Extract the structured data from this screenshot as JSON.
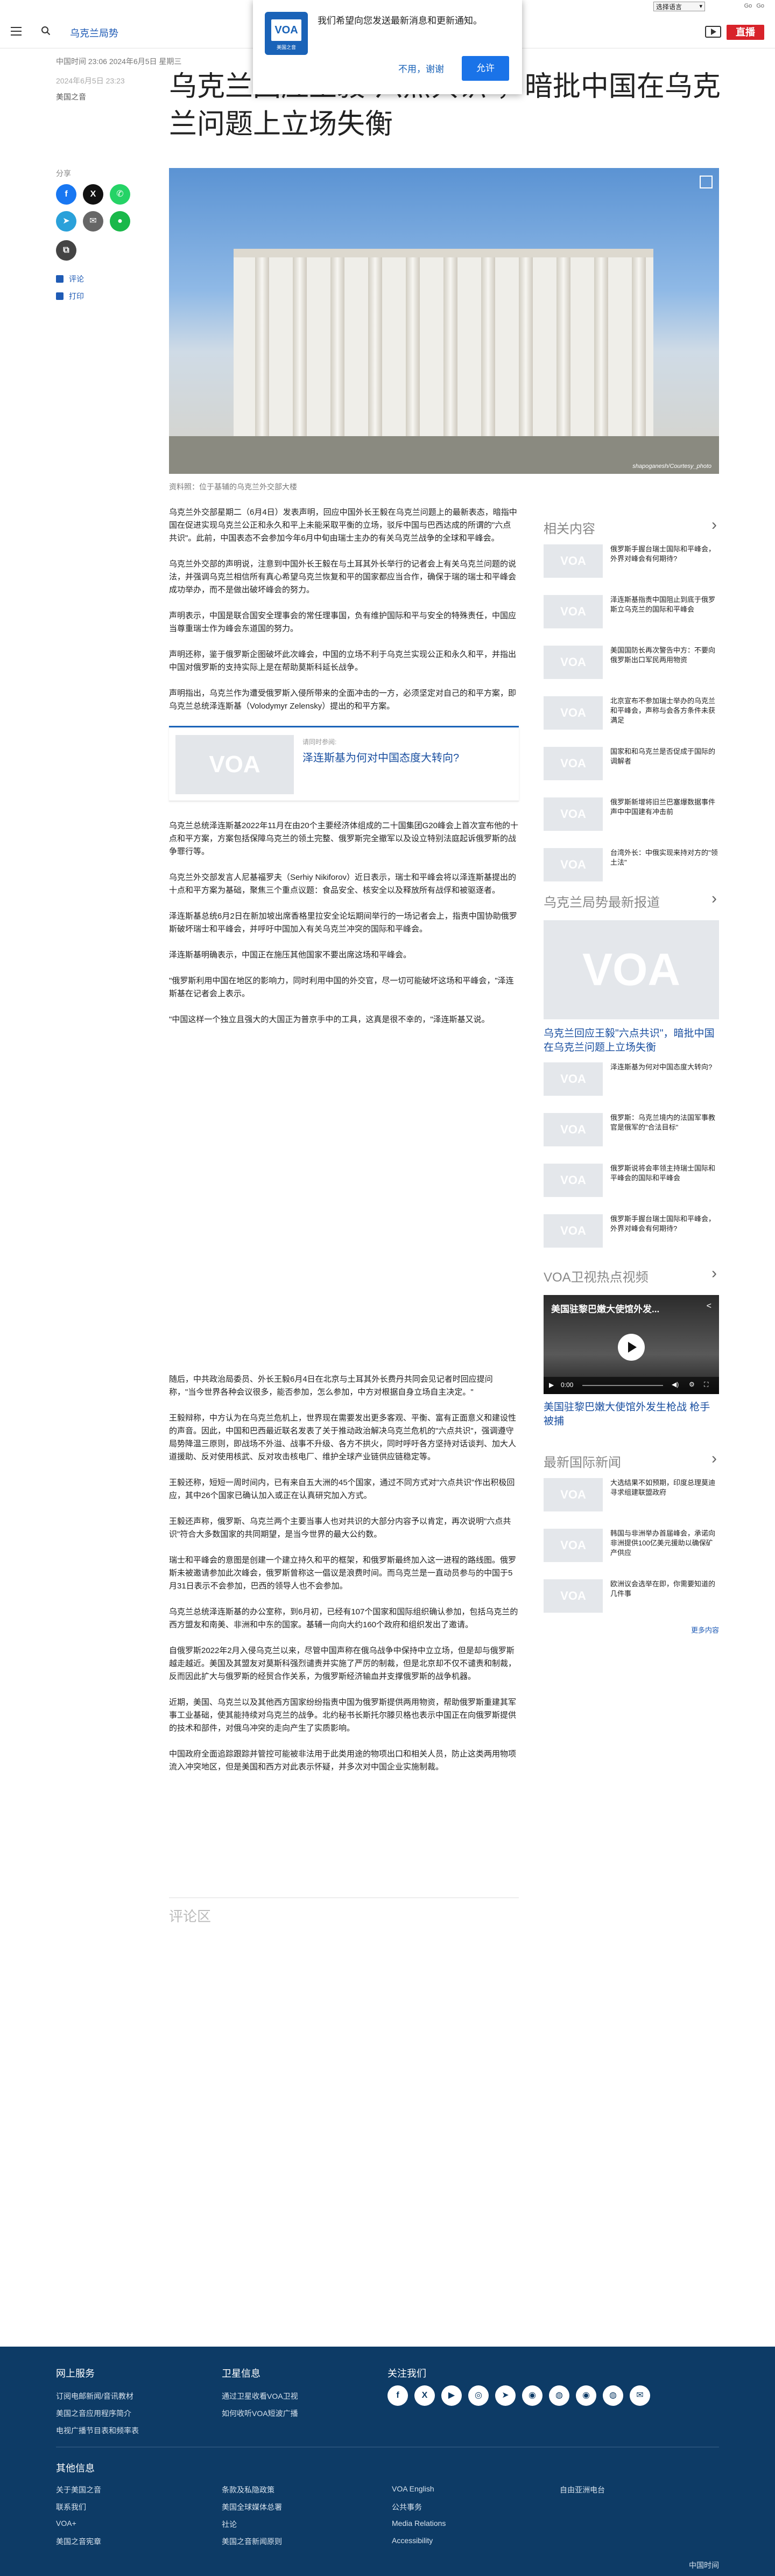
{
  "utility": {
    "language_select": "选择语言",
    "links": [
      "Go",
      "Go"
    ]
  },
  "header": {
    "section": "乌克兰局势",
    "live_label": "直播"
  },
  "notification": {
    "logo_text": "VOA",
    "logo_caption": "美国之音",
    "message": "我们希望向您发送最新消息和更新通知。",
    "no_label": "不用，谢谢",
    "yes_label": "允许"
  },
  "article": {
    "meta_top": "中国时间 23:06 2024年6月5日 星期三",
    "date": "2024年6月5日 23:23",
    "source": "美国之音",
    "title": "乌克兰回应王毅\"六点共识\"，暗批中国在乌克兰问题上立场失衡",
    "share_label": "分享",
    "comment_label": "评论",
    "print_label": "打印",
    "caption": "资料照：位于基辅的乌克兰外交部大楼",
    "photo_credit": "shapoganesh/Courtesy_photo",
    "paragraphs_a": [
      "乌克兰外交部星期二（6月4日）发表声明，回应中国外长王毅在乌克兰问题上的最新表态，暗指中国在促进实现乌克兰公正和永久和平上未能采取平衡的立场，驳斥中国与巴西达成的所谓的\"六点共识\"。此前，中国表态不会参加今年6月中旬由瑞士主办的有关乌克兰战争的全球和平峰会。",
      "乌克兰外交部的声明说，注意到中国外长王毅在与土耳其外长举行的记者会上有关乌克兰问题的说法，并强调乌克兰相信所有真心希望乌克兰恢复和平的国家都应当合作，确保于瑞的瑞士和平峰会成功举办，而不是做出破坏峰会的努力。",
      "声明表示，中国是联合国安全理事会的常任理事国，负有维护国际和平与安全的特殊责任，中国应当尊重瑞士作为峰会东道国的努力。",
      "声明还称，鉴于俄罗斯企图破坏此次峰会，中国的立场不利于乌克兰实现公正和永久和平，并指出中国对俄罗斯的支持实际上是在帮助莫斯科延长战争。",
      "声明指出，乌克兰作为遭受俄罗斯入侵所带来的全面冲击的一方，必须坚定对自己的和平方案，即乌克兰总统泽连斯基（Volodymyr Zelensky）提出的和平方案。"
    ],
    "related": {
      "kicker": "请同时参阅:",
      "title": "泽连斯基为何对中国态度大转向?"
    },
    "paragraphs_b": [
      "乌克兰总统泽连斯基2022年11月在由20个主要经济体组成的二十国集团G20峰会上首次宣布他的十点和平方案，方案包括保障乌克兰的领土完整、俄罗斯完全撤军以及设立特别法庭起诉俄罗斯的战争罪行等。",
      "乌克兰外交部发言人尼基福罗夫（Serhiy Nikiforov）近日表示，瑞士和平峰会将以泽连斯基提出的十点和平方案为基础，聚焦三个重点议题：食品安全、核安全以及释放所有战俘和被驱逐者。",
      "泽连斯基总统6月2日在新加坡出席香格里拉安全论坛期间举行的一场记者会上，指责中国协助俄罗斯破坏瑞士和平峰会，并呼吁中国加入有关乌克兰冲突的国际和平峰会。",
      "泽连斯基明确表示，中国正在施压其他国家不要出席这场和平峰会。",
      "\"俄罗斯利用中国在地区的影响力，同时利用中国的外交官，尽一切可能破坏这场和平峰会，\"泽连斯基在记者会上表示。",
      "\"中国这样一个独立且强大的大国正为普京手中的工具，这真是很不幸的，\"泽连斯基又说。"
    ],
    "paragraphs_c": [
      "随后，中共政治局委员、外长王毅6月4日在北京与土耳其外长费丹共同会见记者时回应提问称，\"当今世界各种会议很多，能否参加，怎么参加，中方对根据自身立场自主决定。\"",
      "王毅辩称，中方认为在乌克兰危机上，世界现在需要发出更多客观、平衡、富有正面意义和建设性的声音。因此，中国和巴西最近联名发表了关于推动政治解决乌克兰危机的\"六点共识\"，强调遵守局势降温三原则，即战场不外溢、战事不升级、各方不拱火，同时呼吁各方坚持对话谈判、加大人道援助、反对使用核武、反对攻击核电厂、维护全球产业链供应链稳定等。",
      "王毅还称，短短一周时间内，已有来自五大洲的45个国家，通过不同方式对\"六点共识\"作出积极回应，其中26个国家已确认加入或正在认真研究加入方式。",
      "王毅还声称，俄罗斯、乌克兰两个主要当事人也对共识的大部分内容予以肯定，再次说明\"六点共识\"符合大多数国家的共同期望，是当今世界的最大公约数。",
      "瑞士和平峰会的意图是创建一个建立持久和平的框架，和俄罗斯最终加入这一进程的路线图。俄罗斯未被邀请参加此次峰会，俄罗斯曾称这一倡议是浪费时间。而乌克兰是一直动员参与的中国于5月31日表示不会参加，巴西的领导人也不会参加。",
      "乌克兰总统泽连斯基的办公室称，到6月初，已经有107个国家和国际组织确认参加，包括乌克兰的西方盟友和南美、非洲和中东的国家。基辅一向向大约160个政府和组织发出了邀请。",
      "自俄罗斯2022年2月入侵乌克兰以来，尽管中国声称在俄乌战争中保持中立立场，但是却与俄罗斯越走越近。美国及其盟友对莫斯科强烈谴责并实施了严厉的制裁，但是北京却不仅不谴责和制裁，反而因此扩大与俄罗斯的经贸合作关系，为俄罗斯经济输血并支撑俄罗斯的战争机器。",
      "近期，美国、乌克兰以及其他西方国家纷纷指责中国为俄罗斯提供两用物资，帮助俄罗斯重建其军事工业基础，使其能持续对乌克兰的战争。北约秘书长斯托尔滕贝格也表示中国正在向俄罗斯提供的技术和部件，对俄乌冲突的走向产生了实质影响。",
      "中国政府全面追踪跟踪并管控可能被非法用于此类用途的物项出口和相关人员，防止这类两用物项流入冲突地区，但是美国和西方对此表示怀疑，并多次对中国企业实施制裁。"
    ],
    "comments_label": "评论区"
  },
  "rail": {
    "related_head": "相关内容",
    "related": [
      "俄罗斯手握台瑞士国际和平峰会，外界对峰会有何期待?",
      "泽连斯基指责中国阻止到底于俄罗斯立乌克兰的国际和平峰会",
      "美国国防长再次警告中方：不要向俄罗斯出口军民两用物资",
      "北京宣布不参加瑞士举办的乌克兰和平峰会，声称与会各方条件未获满足",
      "国家和和乌克兰是否促成于国际的调解者",
      "俄罗斯新增将旧兰巴塞爆数据事件声中中国建有冲击前",
      "台湾外长：中俄实现来持对方的\"领土法\""
    ],
    "news_head": "乌克兰局势最新报道",
    "news_feature": "乌克兰回应王毅\"六点共识\"，暗批中国在乌克兰问题上立场失衡",
    "news_items": [
      "泽连斯基为何对中国态度大转向?",
      "俄罗斯：乌克兰境内的法国军事教官是俄军的\"合法目标\"",
      "俄罗斯说将会率领主持瑞士国际和平峰会的国际和平峰会",
      "俄罗斯手握台瑞士国际和平峰会，外界对峰会有何期待?"
    ],
    "video_head": "VOA卫视热点视频",
    "video_title": "美国驻黎巴嫩大使馆外发生枪战 枪手被捕",
    "video_overlay": "美国驻黎巴嫩大使馆外发...",
    "video_time": "0:00",
    "intl_head": "最新国际新闻",
    "intl_items": [
      "大选结果不如预期，印度总理莫迪寻求组建联盟政府",
      "韩国与非洲举办首届峰会，承诺向非洲提供100亿美元援助以确保矿产供应",
      "欧洲议会选举在即，你需要知道的几件事"
    ],
    "more_label": "更多内容"
  },
  "footer": {
    "col1_head": "网上服务",
    "col1_links": [
      "订阅电邮新闻/音讯教材",
      "美国之音应用程序简介",
      "电视广播节目表和频率表"
    ],
    "col2_head": "卫星信息",
    "col2_links": [
      "通过卫星收看VOA卫视",
      "如何收听VOA短波广播"
    ],
    "col3_head": "关注我们",
    "other_head": "其他信息",
    "other_links": [
      "关于美国之音",
      "联系我们",
      "VOA+",
      "美国之音宪章",
      "条款及私隐政策",
      "美国全球媒体总署",
      "社论",
      "美国之音新闻原则",
      "VOA English",
      "公共事务",
      "Media Relations",
      "Accessibility",
      "自由亚洲电台"
    ],
    "bottom_label": "中国时间",
    "social_icons": [
      "facebook-icon",
      "x-icon",
      "youtube-icon",
      "instagram-icon",
      "telegram-icon",
      "rss-icon",
      "podcast-icon",
      "rss-icon",
      "podcast-icon",
      "email-icon"
    ]
  },
  "colors": {
    "brand": "#1a63b8",
    "live": "#d8232a",
    "footer": "#0d3b66",
    "link": "#1f5bb5"
  }
}
